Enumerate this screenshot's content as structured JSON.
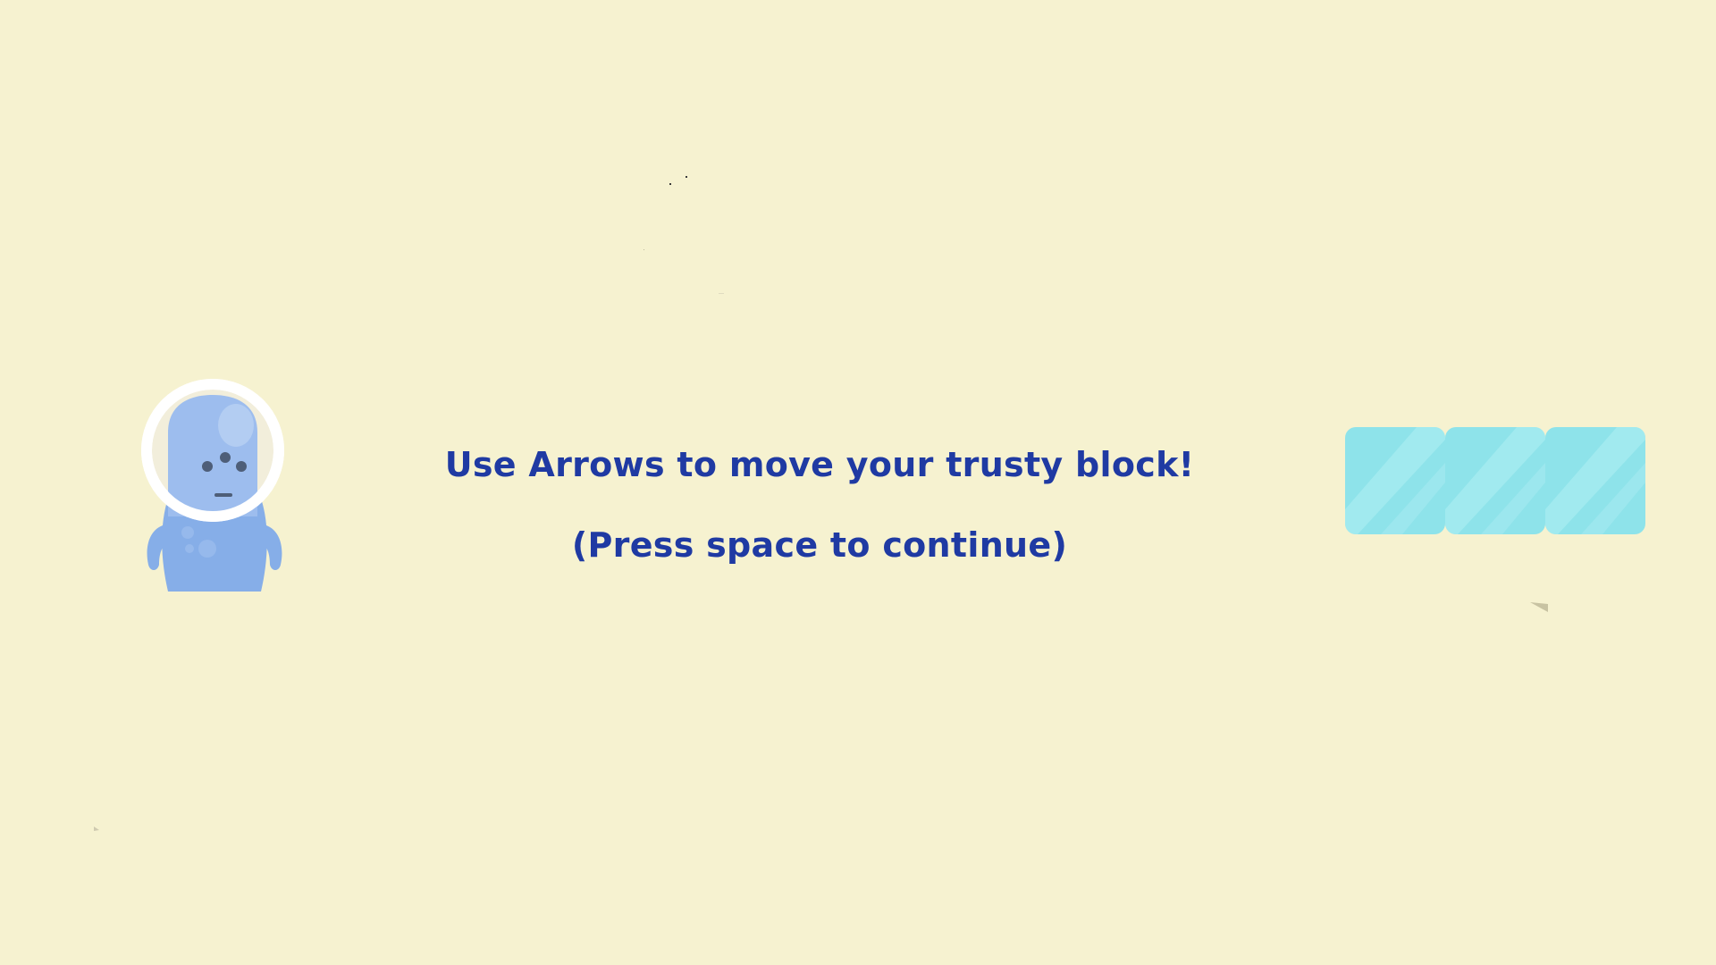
{
  "scene": {
    "background_color": "#f6f2d0",
    "text_color": "#1f3aa3"
  },
  "instructions": {
    "line1": "Use Arrows to move your trusty block!",
    "line2": "(Press space to continue)"
  },
  "sprites": {
    "player": "alien-astronaut-sprite",
    "block": {
      "name": "ice-block",
      "count": 3,
      "color": "#8ee3ea"
    }
  }
}
